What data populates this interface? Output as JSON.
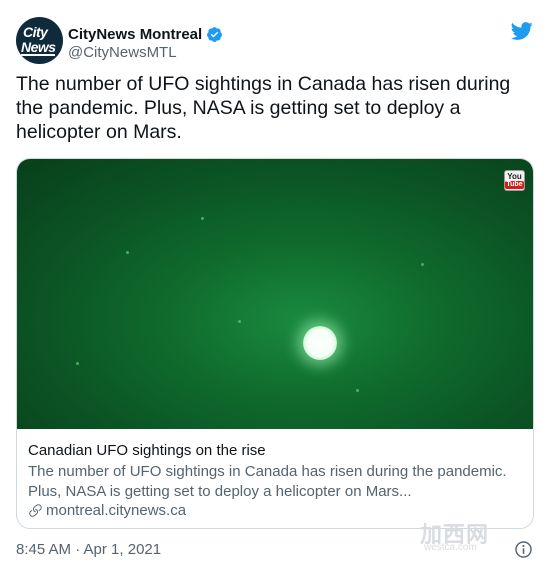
{
  "author": {
    "display_name": "CityNews Montreal",
    "handle": "@CityNewsMTL",
    "avatar_logo_line1": "City",
    "avatar_logo_line2": "News"
  },
  "icons": {
    "verified": "verified-badge-icon",
    "brand": "twitter-bird-icon",
    "link": "link-icon",
    "info": "info-icon",
    "video_source": "youtube-icon"
  },
  "tweet": {
    "text": "The number of UFO sightings in Canada has risen during the pandemic. Plus, NASA is getting set to deploy a helicopter on Mars.",
    "timestamp": "8:45 AM · Apr 1, 2021"
  },
  "card": {
    "title": "Canadian UFO sightings on the rise",
    "description": "The number of UFO sightings in Canada has risen during the pandemic. Plus, NASA is getting set to deploy a helicopter on Mars...",
    "domain": "montreal.citynews.ca",
    "badge_top": "You",
    "badge_bottom": "Tube"
  },
  "watermark": {
    "text": "加西网",
    "url": "westca.com"
  },
  "colors": {
    "twitter_blue": "#1d9bf0",
    "secondary_text": "#536471",
    "image_green": "#0f6a2c"
  }
}
